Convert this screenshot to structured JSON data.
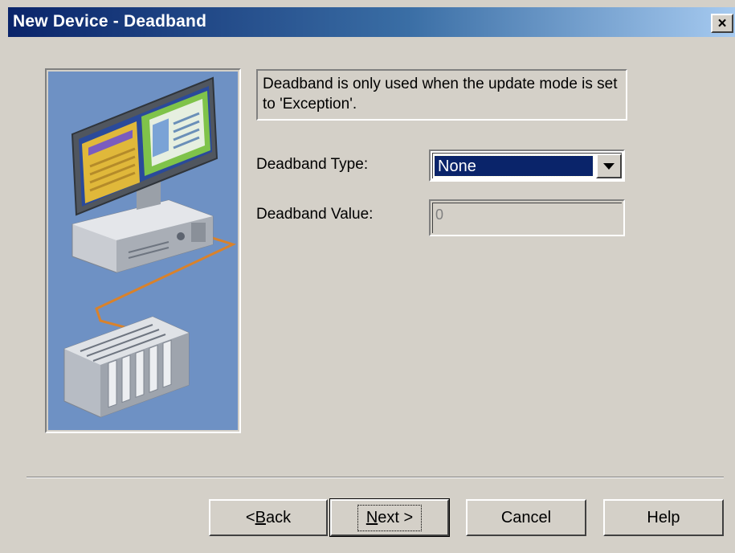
{
  "window": {
    "title": "New Device - Deadband",
    "close_glyph": "✕"
  },
  "illustration": {
    "icon": "computer-plc-network-illustration"
  },
  "info": {
    "text": "Deadband is only used when the update mode is set to 'Exception'."
  },
  "form": {
    "deadband_type_label": "Deadband Type:",
    "deadband_type_value": "None",
    "deadband_value_label": "Deadband Value:",
    "deadband_value": "0"
  },
  "buttons": {
    "back_accel": "B",
    "back_rest": "ack",
    "back_prefix": "< ",
    "next_accel": "N",
    "next_rest": "ext >",
    "cancel": "Cancel",
    "help": "Help"
  },
  "colors": {
    "title_start": "#0a246a",
    "title_end": "#a6caf0",
    "dialog_bg": "#d4d0c8",
    "selection": "#0a246a",
    "illustration_bg": "#6e91c4"
  }
}
